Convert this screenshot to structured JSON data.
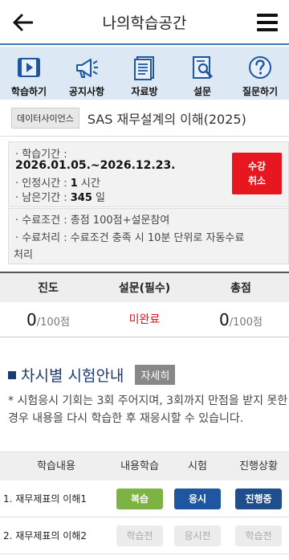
{
  "header": {
    "title": "나의학습공간"
  },
  "nav": [
    {
      "label": "학습하기",
      "icon": "play-icon"
    },
    {
      "label": "공지사항",
      "icon": "megaphone-icon"
    },
    {
      "label": "자료방",
      "icon": "document-icon"
    },
    {
      "label": "설문",
      "icon": "survey-icon"
    },
    {
      "label": "질문하기",
      "icon": "question-icon"
    }
  ],
  "course": {
    "category": "데이터사이언스",
    "title": "SAS 재무설계의 이해(2025)"
  },
  "info": {
    "period_label": "· 학습기간 :",
    "period_value": "2026.01.05.~2026.12.23.",
    "credit_label": "· 인정시간 : ",
    "credit_value": "1",
    "credit_unit": " 시간",
    "remain_label": "· 남은기간 : ",
    "remain_value": "345",
    "remain_unit": " 일",
    "cancel_line1": "수강",
    "cancel_line2": "취소"
  },
  "conditions": {
    "line1": "· 수료조건 : 총점 100점+설문참여",
    "line2": "· 수료처리 : 수료조건 충족 시 10분 단위로 자동수료",
    "line3": "처리"
  },
  "summary": {
    "headers": [
      "진도",
      "설문(필수)",
      "총점"
    ],
    "progress_value": "0",
    "progress_unit": "/100점",
    "survey_status": "미완료",
    "total_value": "0",
    "total_unit": "/100점"
  },
  "exam": {
    "section_title": "차시별 시험안내",
    "detail_button": "자세히",
    "notice": "* 시험응시 기회는 3회 주어지며, 3회까지 만점을 받지 못한 경우 내용을 다시 학습한 후 재응시할 수 있습니다.",
    "headers": [
      "학습내용",
      "내용학습",
      "시험",
      "진행상황"
    ],
    "rows": [
      {
        "name": "1. 재무제표의 이해1",
        "study": "복습",
        "test": "응시",
        "status": "진행중"
      },
      {
        "name": "2. 재무제표의 이해2",
        "study": "학습전",
        "test": "응시전",
        "status": "학습전"
      }
    ]
  },
  "colors": {
    "accent": "#3a78b8",
    "nav_bg": "#dce8f4",
    "cancel": "#e8161f",
    "section": "#1f3a73"
  }
}
